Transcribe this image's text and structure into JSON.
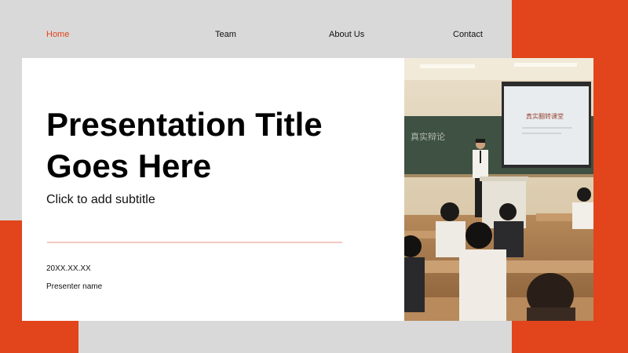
{
  "nav": {
    "items": [
      {
        "label": "Home",
        "active": true
      },
      {
        "label": "Team",
        "active": false
      },
      {
        "label": "About Us",
        "active": false
      },
      {
        "label": "Contact",
        "active": false
      }
    ]
  },
  "slide": {
    "title_line1": "Presentation Title",
    "title_line2": "Goes Here",
    "subtitle": "Click to add subtitle",
    "date": "20XX.XX.XX",
    "presenter": "Presenter name"
  },
  "photo": {
    "board_text": "真实辩论",
    "screen_text": "真实翻转课堂"
  },
  "colors": {
    "accent": "#e2441c",
    "background": "#d9d9d9",
    "card": "#ffffff",
    "divider": "#f2cbbf"
  }
}
